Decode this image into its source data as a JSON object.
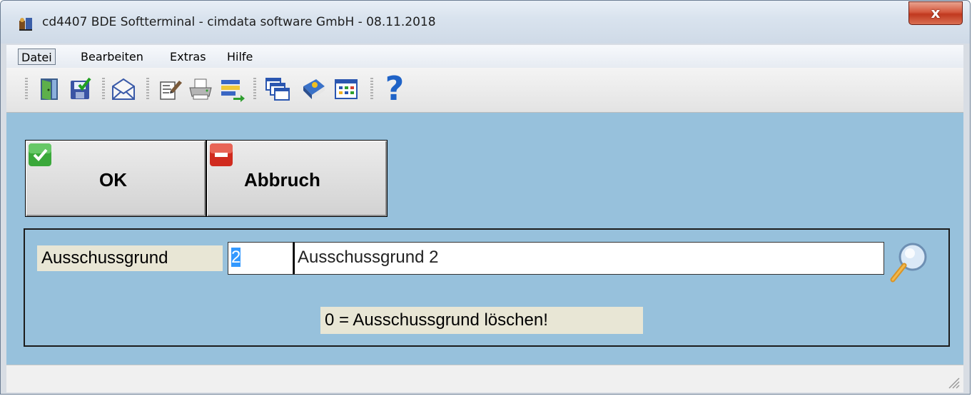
{
  "window": {
    "title": "cd4407 BDE Softterminal - cimdata software GmbH - 08.11.2018",
    "close_label": "x"
  },
  "menu": [
    {
      "label": "Datei"
    },
    {
      "label": "Bearbeiten"
    },
    {
      "label": "Extras"
    },
    {
      "label": "Hilfe"
    }
  ],
  "toolbar": {
    "icons": [
      "exit-door-icon",
      "save-icon",
      "mail-icon",
      "edit-document-icon",
      "printer-icon",
      "transfer-list-icon",
      "windows-cascade-icon",
      "book-icon",
      "calendar-grid-icon",
      "help-icon"
    ],
    "help_glyph": "?"
  },
  "buttons": {
    "ok_label": "OK",
    "cancel_label": "Abbruch"
  },
  "form": {
    "label": "Ausschussgrund",
    "code_value": "2",
    "description_value": "Ausschussgrund 2",
    "hint": "0 = Ausschussgrund löschen!"
  },
  "colors": {
    "content_background": "#97c1dc",
    "label_background": "#e8e6d5",
    "selection": "#3399ff"
  }
}
